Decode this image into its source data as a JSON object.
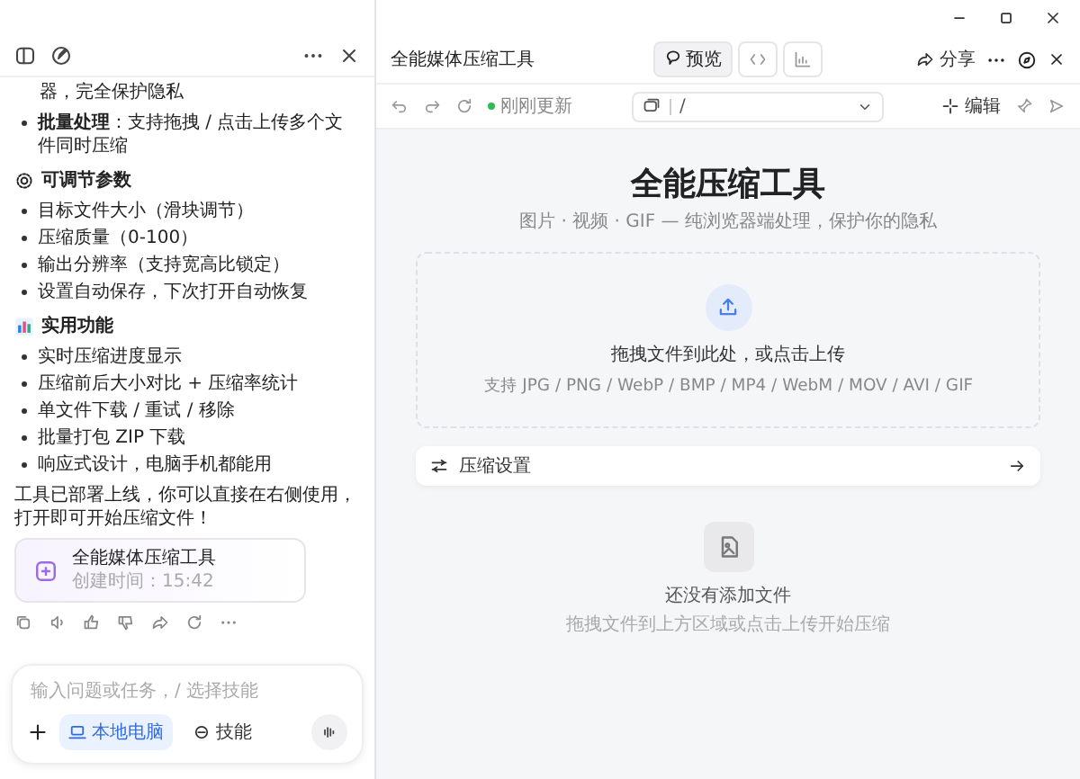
{
  "chat": {
    "intro_tail": "器，完全保护隐私",
    "top_items": [
      "**批量处理**：支持拖拽 / 点击上传多个文件同时压缩"
    ],
    "sections": [
      {
        "heading": "可调节参数",
        "items": [
          "目标文件大小（滑块调节）",
          "压缩质量（0-100）",
          "输出分辨率（支持宽高比锁定）",
          "设置自动保存，下次打开自动恢复"
        ]
      },
      {
        "heading": "实用功能",
        "items": [
          "实时压缩进度显示",
          "压缩前后大小对比 + 压缩率统计",
          "单文件下载 / 重试 / 移除",
          "批量打包 ZIP 下载",
          "响应式设计，电脑手机都能用"
        ]
      }
    ],
    "closing": "工具已部署上线，你可以直接在右侧使用，打开即可开始压缩文件！",
    "artifact": {
      "title": "全能媒体压缩工具",
      "meta": "创建时间：15:42"
    },
    "input": {
      "placeholder": "输入问题或任务，/ 选择技能",
      "chips": [
        {
          "label": "本地电脑",
          "selected": true
        },
        {
          "label": "技能",
          "selected": false
        }
      ]
    }
  },
  "preview": {
    "title": "全能媒体压缩工具",
    "view_tabs": [
      {
        "label": "预览",
        "selected": true
      },
      {
        "selected": false
      },
      {
        "selected": false
      }
    ],
    "share": "分享",
    "status": "刚刚更新",
    "path": "/",
    "edit": "编辑",
    "page": {
      "title": "全能压缩工具",
      "subtitle": "图片 · 视频 · GIF — 纯浏览器端处理，保护你的隐私",
      "dropzone": {
        "main": "拖拽文件到此处，或点击上传",
        "formats": "支持 JPG / PNG / WebP / BMP / MP4 / WebM / MOV / AVI / GIF"
      },
      "settings": "压缩设置",
      "empty": {
        "title": "还没有添加文件",
        "hint": "拖拽文件到上方区域或点击上传开始压缩"
      }
    }
  }
}
